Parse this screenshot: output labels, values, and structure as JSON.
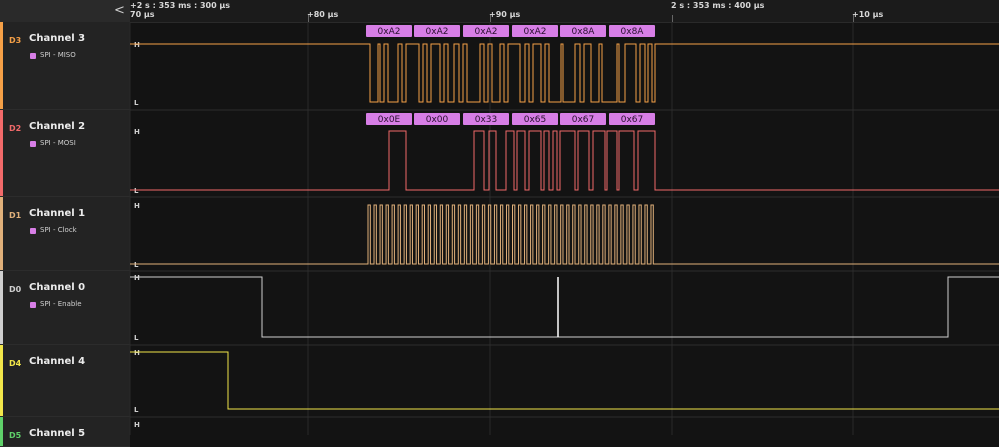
{
  "toolbar": {
    "collapse_icon": "chevron-left-icon",
    "collapse_glyph": "<"
  },
  "ruler": {
    "origin_label": "+2 s : 353 ms : 300 µs",
    "origin_sub": "70 µs",
    "ticks": [
      "+80 µs",
      "+90 µs",
      "2 s : 353 ms : 400 µs",
      "+10 µs"
    ]
  },
  "level_labels": {
    "high": "H",
    "low": "L"
  },
  "channels": [
    {
      "index": "D3",
      "name": "Channel 3",
      "analyzer": "SPI - MISO",
      "color": "#f5a047"
    },
    {
      "index": "D2",
      "name": "Channel 2",
      "analyzer": "SPI - MOSI",
      "color": "#f26a6a"
    },
    {
      "index": "D1",
      "name": "Channel 1",
      "analyzer": "SPI - Clock",
      "color": "#e0b07a"
    },
    {
      "index": "D0",
      "name": "Channel 0",
      "analyzer": "SPI - Enable",
      "color": "#cfcfcf"
    },
    {
      "index": "D4",
      "name": "Channel 4",
      "analyzer": "",
      "color": "#f2e64a"
    },
    {
      "index": "D5",
      "name": "Channel 5",
      "analyzer": "",
      "color": "#5fd16a"
    }
  ],
  "decoded": {
    "miso": [
      "0xA2",
      "0xA2",
      "0xA2",
      "0xA2",
      "0x8A",
      "0x8A"
    ],
    "mosi": [
      "0x0E",
      "0x00",
      "0x33",
      "0x65",
      "0x67",
      "0x67"
    ],
    "bubble_color": "#d77ee6"
  }
}
